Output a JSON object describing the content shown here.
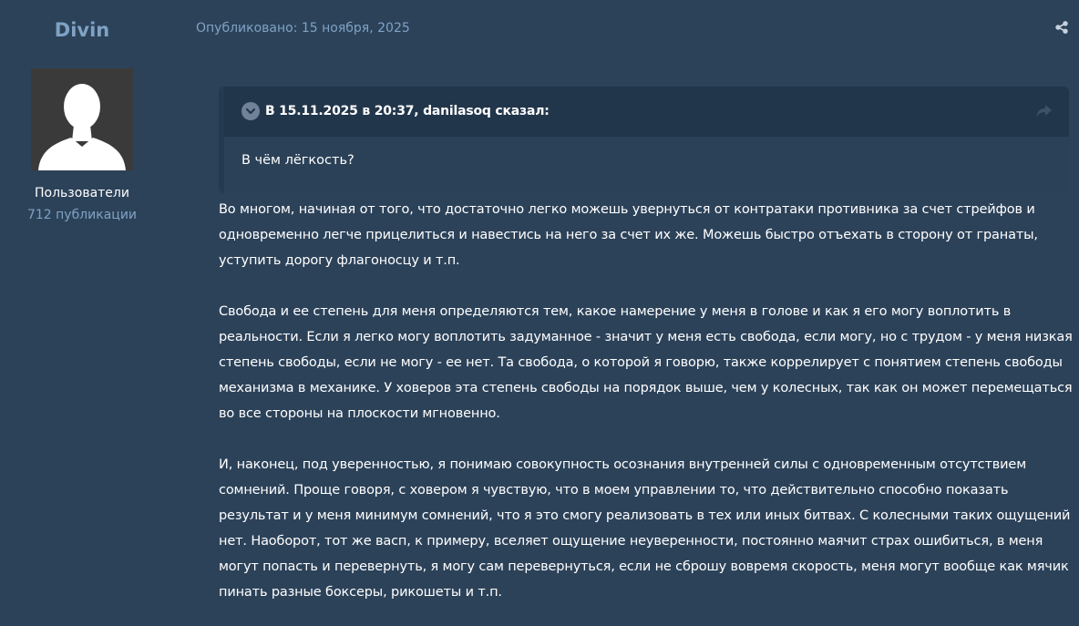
{
  "author": {
    "name": "Divin",
    "group": "Пользователи",
    "posts": "712 публикации"
  },
  "post": {
    "date": "Опубликовано: 15 ноября, 2025",
    "quote": {
      "citation": "В 15.11.2025 в 20:37, danilasoq сказал:",
      "text": "В чём лёгкость?"
    },
    "paragraphs": [
      "Во многом, начиная от того, что достаточно легко можешь увернуться от контратаки противника за счет стрейфов и одновременно легче прицелиться и навестись на него за счет их же. Можешь быстро отъехать в сторону от гранаты, уступить дорогу флагоносцу и т.п.",
      "Свобода и ее степень для меня определяются тем, какое намерение у меня в голове и как я его могу воплотить в реальности.  Если я легко могу воплотить задуманное - значит у меня есть свобода, если могу, но с трудом - у меня низкая степень свободы, если не могу - ее нет. Та свобода, о которой я говорю, также коррелирует с понятием степень свободы механизма в механике. У ховеров эта степень свободы на порядок выше, чем у колесных, так как он может перемещаться во все стороны на плоскости мгновенно.",
      "И, наконец, под уверенностью, я понимаю совокупность  осознания внутренней силы с одновременным отсутствием сомнений. Проще говоря, с ховером я чувствую, что в моем управлении то, что действительно способно показать результат и у меня минимум сомнений, что я это смогу реализовать в тех или иных битвах. С колесными таких ощущений нет. Наоборот, тот же васп, к примеру, вселяет ощущение неуверенности, постоянно маячит страх ошибиться, в меня могут попасть и перевернуть, я могу сам перевернуться, если не сброшу вовремя скорость, меня могут вообще как мячик пинать разные боксеры, рикошеты и т.п."
    ]
  },
  "icons": {
    "share": "share-icon",
    "toggle": "chevron-down-icon",
    "goto": "reply-arrow-icon",
    "avatar": "default-user-silhouette"
  },
  "colors": {
    "background": "#2c4259",
    "accent": "#7fa2c4",
    "quote_header": "#22364b",
    "quote_body": "#2b4157"
  }
}
